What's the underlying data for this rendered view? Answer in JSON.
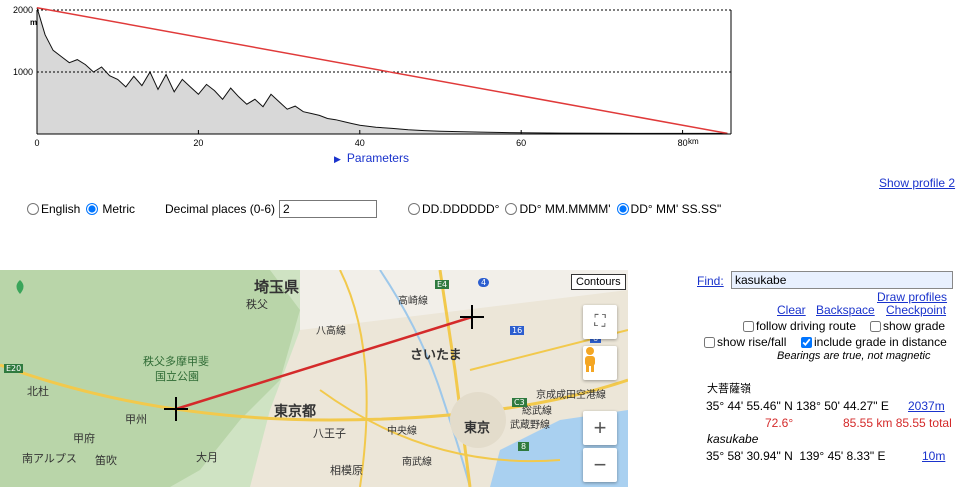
{
  "chart_data": {
    "type": "area",
    "title": "",
    "xlabel": "",
    "ylabel": "",
    "x_unit": "km",
    "y_unit": "m",
    "xlim": [
      0,
      86
    ],
    "ylim": [
      0,
      2000
    ],
    "x_ticks": [
      0,
      20,
      40,
      60,
      80
    ],
    "y_ticks": [
      1000,
      2000
    ],
    "series": [
      {
        "kind": "elevation",
        "x": [
          0,
          1,
          2,
          3,
          4,
          5,
          6,
          7,
          8,
          9,
          10,
          11,
          12,
          13,
          14,
          15,
          16,
          17,
          18,
          19,
          20,
          21,
          22,
          23,
          24,
          25,
          26,
          27,
          28,
          29,
          30,
          31,
          32,
          33,
          34,
          35,
          36,
          37,
          38,
          39,
          40,
          42,
          44,
          46,
          48,
          50,
          55,
          60,
          65,
          70,
          75,
          80,
          85.55
        ],
        "y": [
          2037,
          1600,
          1350,
          1250,
          1150,
          1200,
          1120,
          1000,
          1080,
          940,
          880,
          760,
          930,
          780,
          1000,
          720,
          960,
          680,
          880,
          760,
          640,
          800,
          700,
          560,
          740,
          600,
          480,
          560,
          440,
          640,
          520,
          400,
          450,
          360,
          330,
          300,
          250,
          230,
          200,
          170,
          140,
          110,
          90,
          70,
          55,
          45,
          30,
          20,
          15,
          12,
          10,
          10,
          10
        ]
      },
      {
        "kind": "line-of-sight",
        "x": [
          0,
          85.55
        ],
        "y": [
          2037,
          10
        ]
      }
    ]
  },
  "ui": {
    "params_label": "Parameters",
    "show_profile": "Show profile 2",
    "units": [
      {
        "label": "English",
        "checked": false
      },
      {
        "label": "Metric",
        "checked": true
      }
    ],
    "decimal_label": "Decimal places (0-6)",
    "decimal_value": "2",
    "coord_formats": [
      {
        "label": "DD.DDDDDD°",
        "checked": false
      },
      {
        "label": "DD° MM.MMMM'",
        "checked": false
      },
      {
        "label": "DD° MM' SS.SS\"",
        "checked": true
      }
    ]
  },
  "map": {
    "contours": "Contours",
    "zoom_in": "+",
    "zoom_out": "−",
    "labels": {
      "saitama_pref": "埼玉県",
      "chichibu": "秩父",
      "park": "秩父多摩甲斐",
      "park2": "国立公園",
      "hokuto": "北杜",
      "koshu": "甲州",
      "kofu": "甲府",
      "minami_alps": "南アルプス",
      "fuefuki": "笛吹",
      "otsuki": "大月",
      "tokyo_to": "東京都",
      "hachioji": "八王子",
      "sagamihara": "相模原",
      "saitama_city": "さいたま",
      "tokyo": "東京",
      "chuo_line": "中央線",
      "musashino": "武蔵野線",
      "keisei": "京成成田空港線",
      "sobu": "総武線",
      "nambu": "南武線",
      "hachiko": "八高線",
      "takasaki": "高崎線",
      "e20": "E20",
      "e4": "E4",
      "c3": "C3",
      "r4": "4",
      "r16": "16",
      "r6": "6",
      "r8": "8"
    }
  },
  "panel": {
    "find_label": "Find:",
    "find_value": "kasukabe",
    "draw_profiles": "Draw profiles",
    "clear": "Clear",
    "backspace": "Backspace",
    "checkpoint": "Checkpoint",
    "follow_route": "follow driving route",
    "show_grade": "show grade",
    "show_rise": "show rise/fall",
    "include_grade": "include grade in distance",
    "bearings_note": "Bearings are true, not magnetic",
    "point1_name": "大菩薩嶺",
    "point1_coords": "35° 44' 55.46\" N 138° 50' 44.27\" E",
    "point1_elev": "2037m",
    "bearing": "72.6°",
    "distance": "85.55 km 85.55 total",
    "point2_name": "kasukabe",
    "point2_coords": "35° 58' 30.94\" N  139° 45' 8.33\" E",
    "point2_elev": "10m"
  },
  "colors": {
    "link": "#1a33cc",
    "accent_red": "#d42a2a",
    "profile_fill": "#d8d8d8"
  }
}
